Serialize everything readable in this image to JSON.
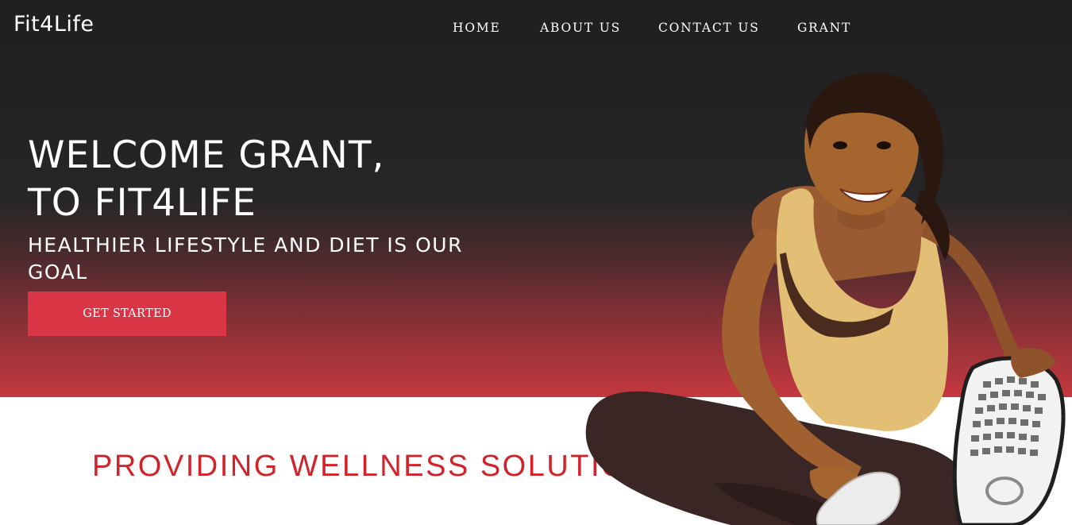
{
  "header": {
    "brand": "Fit4Life",
    "nav": [
      {
        "label": "HOME"
      },
      {
        "label": "ABOUT US"
      },
      {
        "label": "CONTACT US"
      },
      {
        "label": "GRANT"
      }
    ]
  },
  "hero": {
    "title_line1": "WELCOME GRANT,",
    "title_line2": "TO FIT4LIFE",
    "subtitle": "HEALTHIER LIFESTYLE AND DIET IS OUR GOAL",
    "cta_label": "GET STARTED",
    "image": "woman-stretching-photo"
  },
  "section": {
    "tagline": "PROVIDING WELLNESS SOLUTIONS"
  },
  "colors": {
    "accent": "#d93545",
    "tagline": "#d2232a",
    "hero_top": "#1f1f1f",
    "hero_bottom": "#c5383f"
  }
}
